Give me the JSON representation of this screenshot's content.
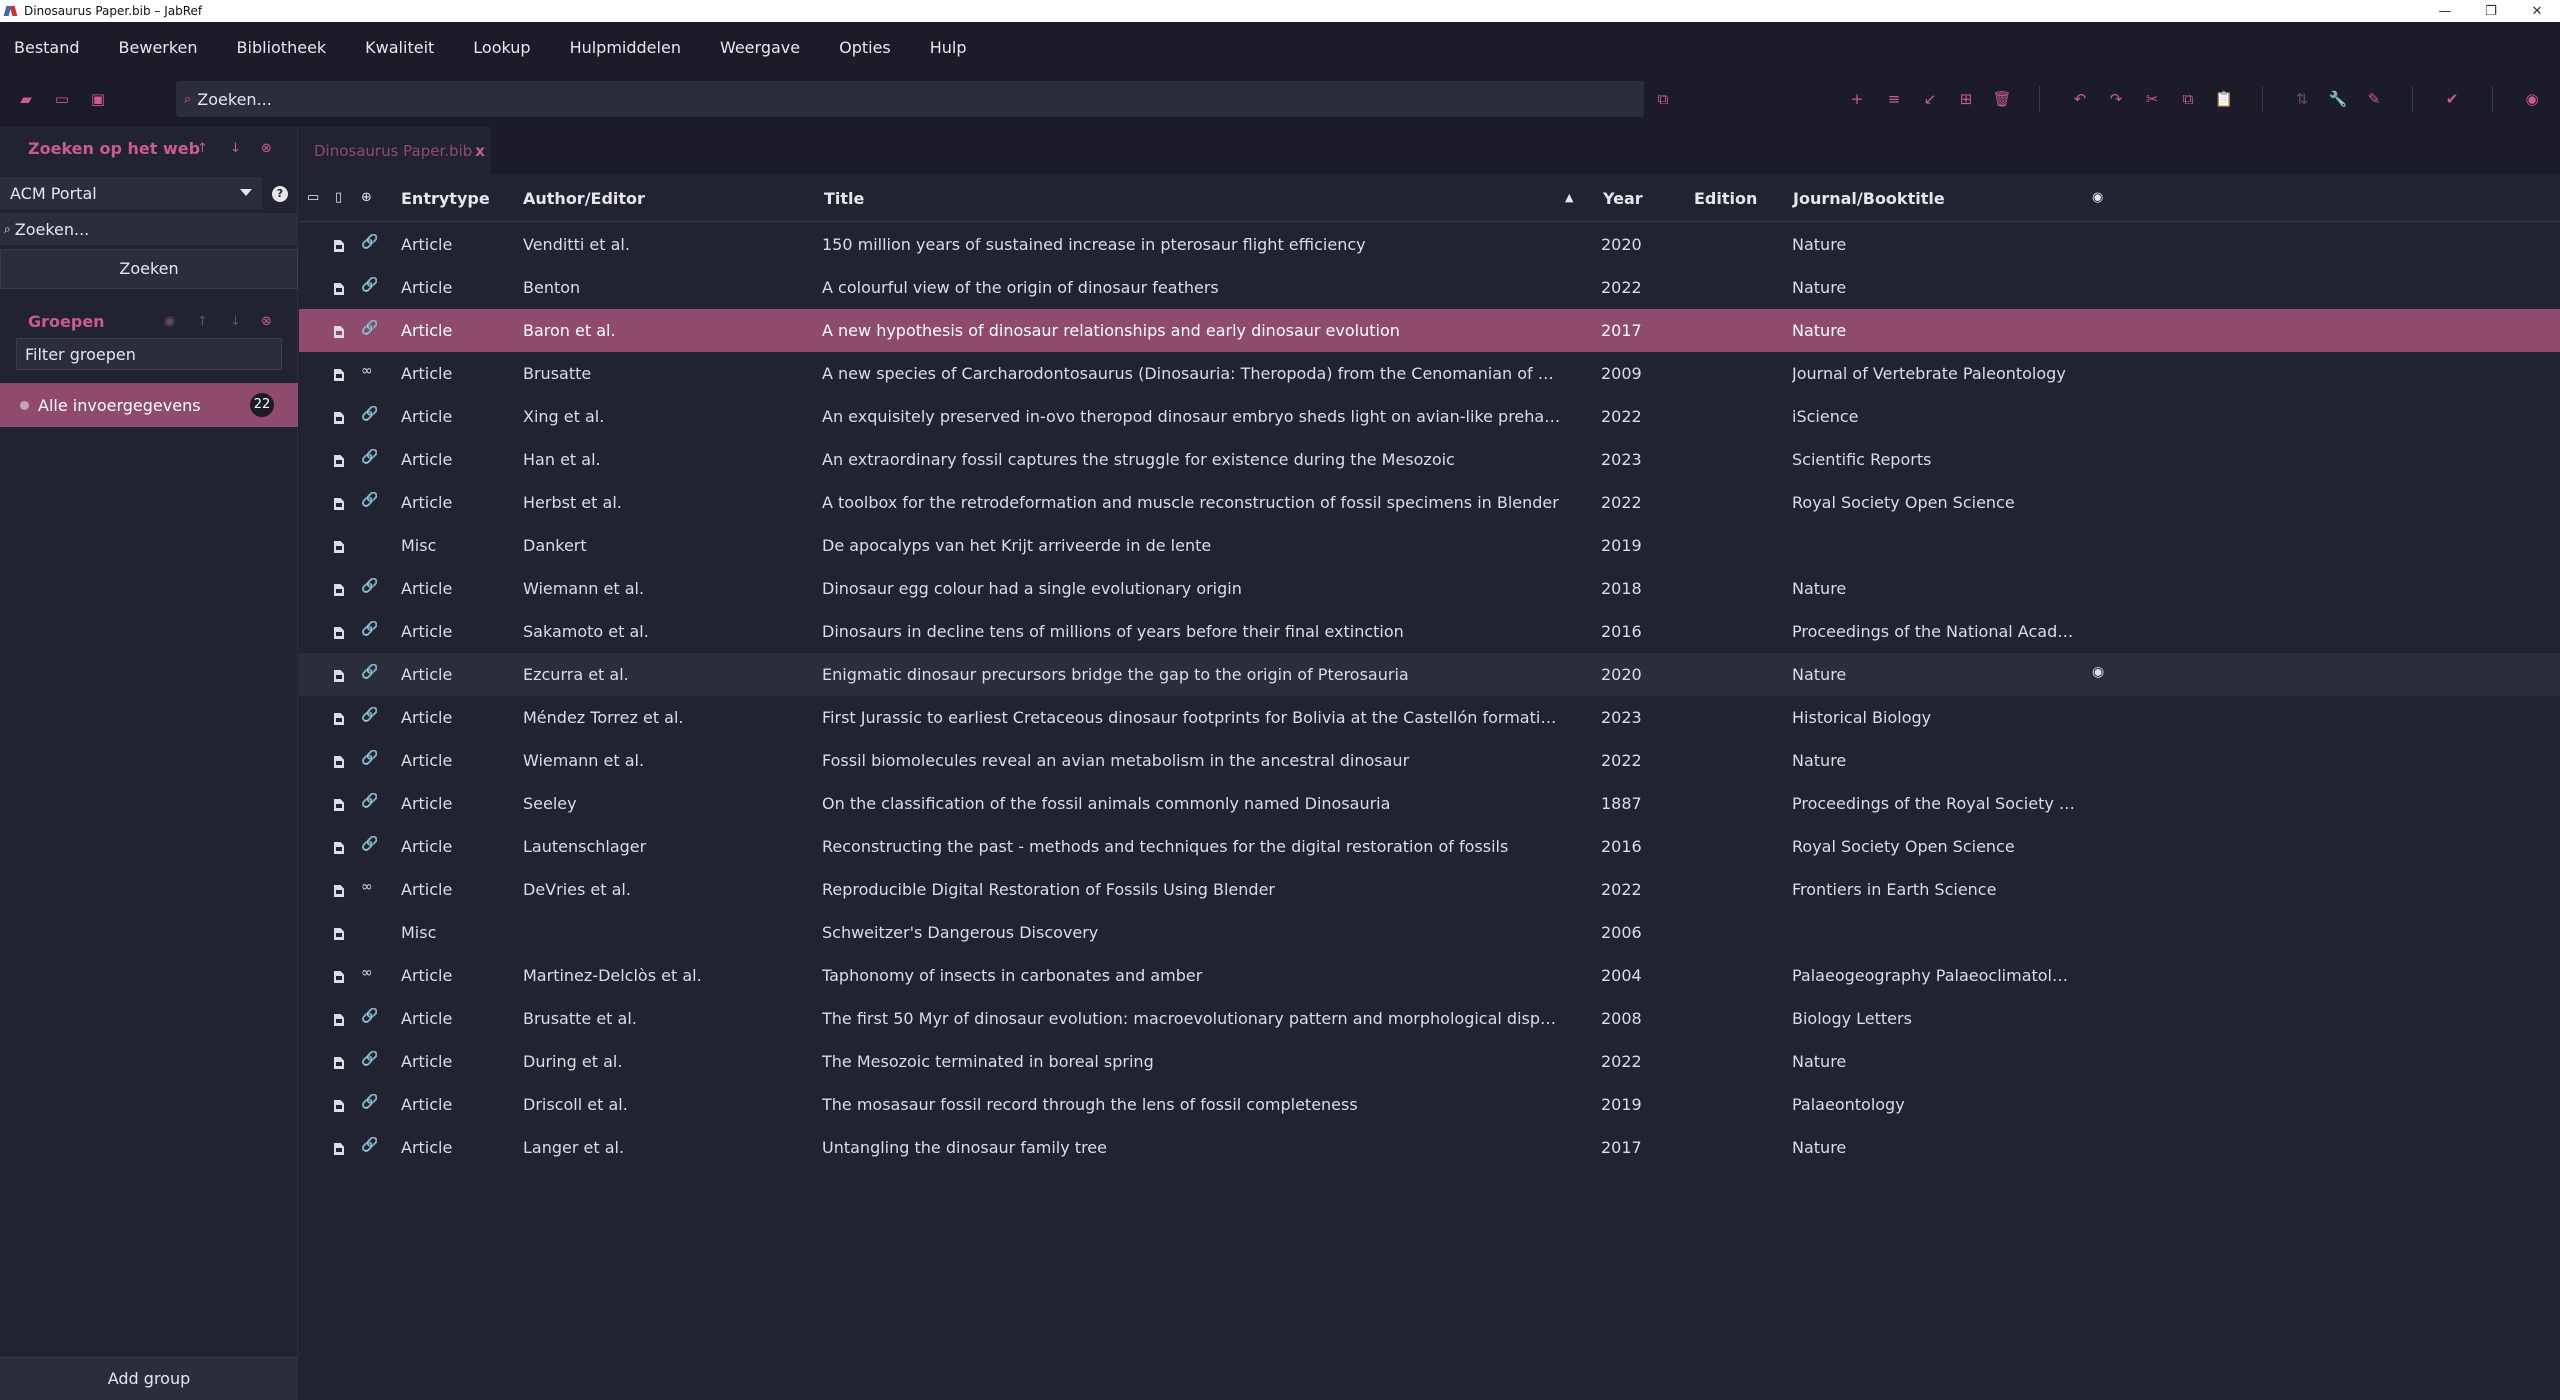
{
  "window": {
    "title": "Dinosaurus Paper.bib – JabRef",
    "minimize": "—",
    "restore": "❐",
    "close": "✕"
  },
  "menu": [
    "Bestand",
    "Bewerken",
    "Bibliotheek",
    "Kwaliteit",
    "Lookup",
    "Hulpmiddelen",
    "Weergave",
    "Opties",
    "Hulp"
  ],
  "toolbar": {
    "search_placeholder": "Zoeken..."
  },
  "sidebar": {
    "web_search_title": "Zoeken op het web",
    "fetcher": "ACM Portal",
    "web_query_placeholder": "Zoeken...",
    "search_button": "Zoeken",
    "groups_title": "Groepen",
    "filter_placeholder": "Filter groepen",
    "all_entries_label": "Alle invoergegevens",
    "all_entries_count": "22",
    "add_group": "Add group"
  },
  "tab": {
    "label": "Dinosaurus Paper.bib",
    "close": "x"
  },
  "table": {
    "columns": {
      "entrytype": "Entrytype",
      "author": "Author/Editor",
      "title": "Title",
      "year": "Year",
      "edition": "Edition",
      "journal": "Journal/Booktitle"
    },
    "sort_indicator": "▲",
    "rows": [
      {
        "type": "Article",
        "author": "Venditti et al.",
        "title": "150 million years of sustained increase in pterosaur flight efficiency",
        "year": "2020",
        "journal": "Nature",
        "link": "🔗"
      },
      {
        "type": "Article",
        "author": "Benton",
        "title": "A colourful view of the origin of dinosaur feathers",
        "year": "2022",
        "journal": "Nature",
        "link": "🔗"
      },
      {
        "type": "Article",
        "author": "Baron et al.",
        "title": "A new hypothesis of dinosaur relationships and early dinosaur evolution",
        "year": "2017",
        "journal": "Nature",
        "link": "🔗"
      },
      {
        "type": "Article",
        "author": "Brusatte",
        "title": "A new species of Carcharodontosaurus (Dinosauria: Theropoda) from the Cenomanian of Niger and a re...",
        "year": "2009",
        "journal": "Journal of Vertebrate Paleontology",
        "link": "∞"
      },
      {
        "type": "Article",
        "author": "Xing et al.",
        "title": "An exquisitely preserved in-ovo theropod dinosaur embryo sheds light on avian-like prehatching postur...",
        "year": "2022",
        "journal": "iScience",
        "link": "🔗"
      },
      {
        "type": "Article",
        "author": "Han et al.",
        "title": "An extraordinary fossil captures the struggle for existence during the Mesozoic",
        "year": "2023",
        "journal": "Scientific Reports",
        "link": "🔗"
      },
      {
        "type": "Article",
        "author": "Herbst et al.",
        "title": "A toolbox for the retrodeformation and muscle reconstruction of fossil specimens in Blender",
        "year": "2022",
        "journal": "Royal Society Open Science",
        "link": "🔗"
      },
      {
        "type": "Misc",
        "author": "Dankert",
        "title": "De apocalyps van het Krijt arriveerde in de lente",
        "year": "2019",
        "journal": "",
        "link": ""
      },
      {
        "type": "Article",
        "author": "Wiemann et al.",
        "title": "Dinosaur egg colour had a single evolutionary origin",
        "year": "2018",
        "journal": "Nature",
        "link": "🔗"
      },
      {
        "type": "Article",
        "author": "Sakamoto et al.",
        "title": "Dinosaurs in decline tens of millions of years before their final extinction",
        "year": "2016",
        "journal": "Proceedings of the National Academ...",
        "link": "🔗"
      },
      {
        "type": "Article",
        "author": "Ezcurra et al.",
        "title": "Enigmatic dinosaur precursors bridge the gap to the origin of Pterosauria",
        "year": "2020",
        "journal": "Nature",
        "link": "🔗"
      },
      {
        "type": "Article",
        "author": "Méndez Torrez et al.",
        "title": "First Jurassic to earliest Cretaceous dinosaur footprints for Bolivia at the Castellón formation (Tacurú Gro...",
        "year": "2023",
        "journal": "Historical Biology",
        "link": "🔗"
      },
      {
        "type": "Article",
        "author": "Wiemann et al.",
        "title": "Fossil biomolecules reveal an avian metabolism in the ancestral dinosaur",
        "year": "2022",
        "journal": "Nature",
        "link": "🔗"
      },
      {
        "type": "Article",
        "author": "Seeley",
        "title": "On the classification of the fossil animals commonly named Dinosauria",
        "year": "1887",
        "journal": "Proceedings of the Royal Society of L...",
        "link": "🔗"
      },
      {
        "type": "Article",
        "author": "Lautenschlager",
        "title": "Reconstructing the past - methods and techniques for the digital restoration of fossils",
        "year": "2016",
        "journal": "Royal Society Open Science",
        "link": "🔗"
      },
      {
        "type": "Article",
        "author": "DeVries et al.",
        "title": "Reproducible Digital Restoration of Fossils Using Blender",
        "year": "2022",
        "journal": "Frontiers in Earth Science",
        "link": "∞"
      },
      {
        "type": "Misc",
        "author": "",
        "title": "Schweitzer's Dangerous Discovery",
        "year": "2006",
        "journal": "",
        "link": ""
      },
      {
        "type": "Article",
        "author": "Martinez-Delclòs et al.",
        "title": "Taphonomy of insects in carbonates and amber",
        "year": "2004",
        "journal": "Palaeogeography Palaeoclimatology ...",
        "link": "∞"
      },
      {
        "type": "Article",
        "author": "Brusatte et al.",
        "title": "The first 50 Myr of dinosaur evolution: macroevolutionary pattern and morphological disparity",
        "year": "2008",
        "journal": "Biology Letters",
        "link": "🔗"
      },
      {
        "type": "Article",
        "author": "During et al.",
        "title": "The Mesozoic terminated in boreal spring",
        "year": "2022",
        "journal": "Nature",
        "link": "🔗"
      },
      {
        "type": "Article",
        "author": "Driscoll et al.",
        "title": "The mosasaur fossil record through the lens of fossil completeness",
        "year": "2019",
        "journal": "Palaeontology",
        "link": "🔗"
      },
      {
        "type": "Article",
        "author": "Langer et al.",
        "title": "Untangling the dinosaur family tree",
        "year": "2017",
        "journal": "Nature",
        "link": "🔗"
      }
    ],
    "selected_row_index": 2,
    "hover_row_index": 10,
    "multi_file_rows": [
      12,
      21
    ]
  },
  "colors": {
    "accent": "#c85c8e",
    "selection": "#8f4b6b",
    "background": "#212330",
    "toolbar": "#1b1c27"
  }
}
